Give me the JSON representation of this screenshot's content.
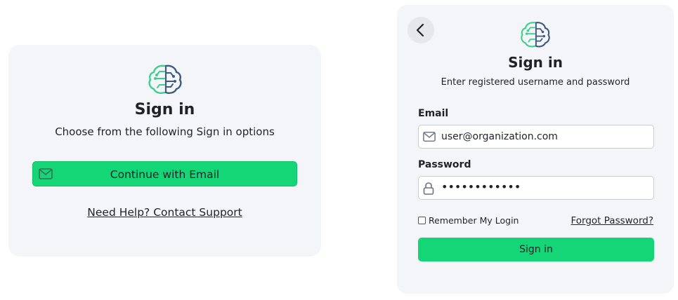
{
  "choose_card": {
    "logo_icon": "brain-logo-icon",
    "title": "Sign in",
    "subtitle": "Choose from the following Sign in options",
    "email_button": {
      "icon": "mail-icon",
      "label": "Continue with Email"
    },
    "help_link": "Need Help? Contact Support"
  },
  "login_card": {
    "back_icon": "chevron-left-icon",
    "logo_icon": "brain-logo-icon",
    "title": "Sign in",
    "subtitle": "Enter registered username and password",
    "email": {
      "label": "Email",
      "icon": "mail-icon",
      "value": "user@organization.com"
    },
    "password": {
      "label": "Password",
      "icon": "lock-icon",
      "value": "••••••••••••"
    },
    "remember_label": "Remember My Login",
    "remember_checked": false,
    "forgot_link": "Forgot Password?",
    "submit_label": "Sign in"
  },
  "colors": {
    "accent": "#14d677",
    "card_background": "#f4f5f8",
    "logo_green": "#3ecf8e",
    "logo_navy": "#3d5a80"
  }
}
